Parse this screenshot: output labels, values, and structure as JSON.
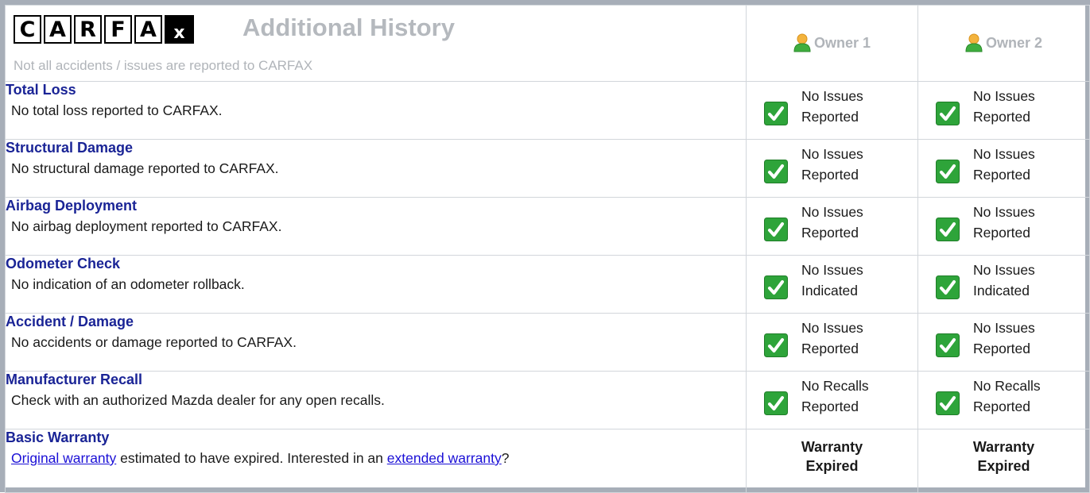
{
  "header": {
    "logo_letters": [
      "C",
      "A",
      "R",
      "F",
      "A",
      "x"
    ],
    "title": "Additional History",
    "subtitle": "Not all accidents / issues are reported to CARFAX",
    "owners": [
      "Owner 1",
      "Owner 2"
    ]
  },
  "items": [
    {
      "title": "Total Loss",
      "desc": "No total loss reported to CARFAX.",
      "owner1": [
        "No Issues",
        "Reported"
      ],
      "owner2": [
        "No Issues",
        "Reported"
      ]
    },
    {
      "title": "Structural Damage",
      "desc": "No structural damage reported to CARFAX.",
      "owner1": [
        "No Issues",
        "Reported"
      ],
      "owner2": [
        "No Issues",
        "Reported"
      ]
    },
    {
      "title": "Airbag Deployment",
      "desc": "No airbag deployment reported to CARFAX.",
      "owner1": [
        "No Issues",
        "Reported"
      ],
      "owner2": [
        "No Issues",
        "Reported"
      ]
    },
    {
      "title": "Odometer Check",
      "desc": "No indication of an odometer rollback.",
      "owner1": [
        "No Issues",
        "Indicated"
      ],
      "owner2": [
        "No Issues",
        "Indicated"
      ]
    },
    {
      "title": "Accident / Damage",
      "desc": "No accidents or damage reported to CARFAX.",
      "owner1": [
        "No Issues",
        "Reported"
      ],
      "owner2": [
        "No Issues",
        "Reported"
      ]
    },
    {
      "title": "Manufacturer Recall",
      "desc": "Check with an authorized Mazda dealer for any open recalls.",
      "owner1": [
        "No Recalls",
        "Reported"
      ],
      "owner2": [
        "No Recalls",
        "Reported"
      ]
    }
  ],
  "warranty": {
    "title": "Basic Warranty",
    "link1": "Original warranty",
    "text1": " estimated to have expired. Interested in an ",
    "link2": "extended warranty",
    "text2": "?",
    "owner1": [
      "Warranty",
      "Expired"
    ],
    "owner2": [
      "Warranty",
      "Expired"
    ]
  },
  "icons": {
    "owner": "person-icon",
    "status": "check-icon"
  },
  "colors": {
    "title_blue": "#1a2496",
    "link_blue": "#1a0fd6",
    "check_green": "#2ea43a",
    "border": "#a7aeb8"
  }
}
